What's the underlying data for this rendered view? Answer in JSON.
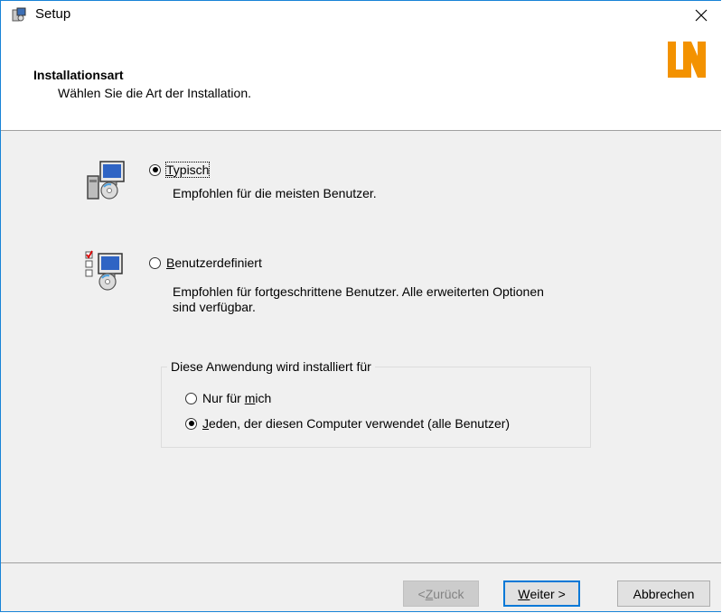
{
  "window": {
    "title": "Setup",
    "close_symbol": "✕"
  },
  "header": {
    "title": "Installationsart",
    "subtitle": "Wählen Sie die Art der Installation.",
    "logo_text": "LN",
    "logo_color": "#f39200"
  },
  "options": [
    {
      "accesskey": "T",
      "rest": "ypisch",
      "checked": true,
      "description": "Empfohlen für die meisten Benutzer.",
      "icon": "setup-typical-icon"
    },
    {
      "accesskey": "B",
      "rest": "enutzerdefiniert",
      "checked": false,
      "description_line1": "Empfohlen für fortgeschrittene Benutzer. Alle erweiterten Optionen",
      "description_line2": "sind verfügbar.",
      "icon": "setup-custom-icon"
    }
  ],
  "install_for": {
    "legend": "Diese Anwendung wird installiert für",
    "choices": [
      {
        "pre": "Nur für ",
        "accesskey": "m",
        "post": "ich",
        "checked": false
      },
      {
        "pre": "",
        "accesskey": "J",
        "post": "eden, der diesen Computer verwendet (alle Benutzer)",
        "checked": true
      }
    ]
  },
  "buttons": {
    "back": {
      "pre": "< ",
      "accesskey": "Z",
      "post": "urück",
      "disabled": true
    },
    "next": {
      "accesskey": "W",
      "post": "eiter >",
      "default": true
    },
    "cancel": {
      "label": "Abbrechen"
    }
  },
  "colors": {
    "accent": "#0078d7",
    "window_border": "#1883d7",
    "dialog_bg": "#f0f0f0"
  }
}
